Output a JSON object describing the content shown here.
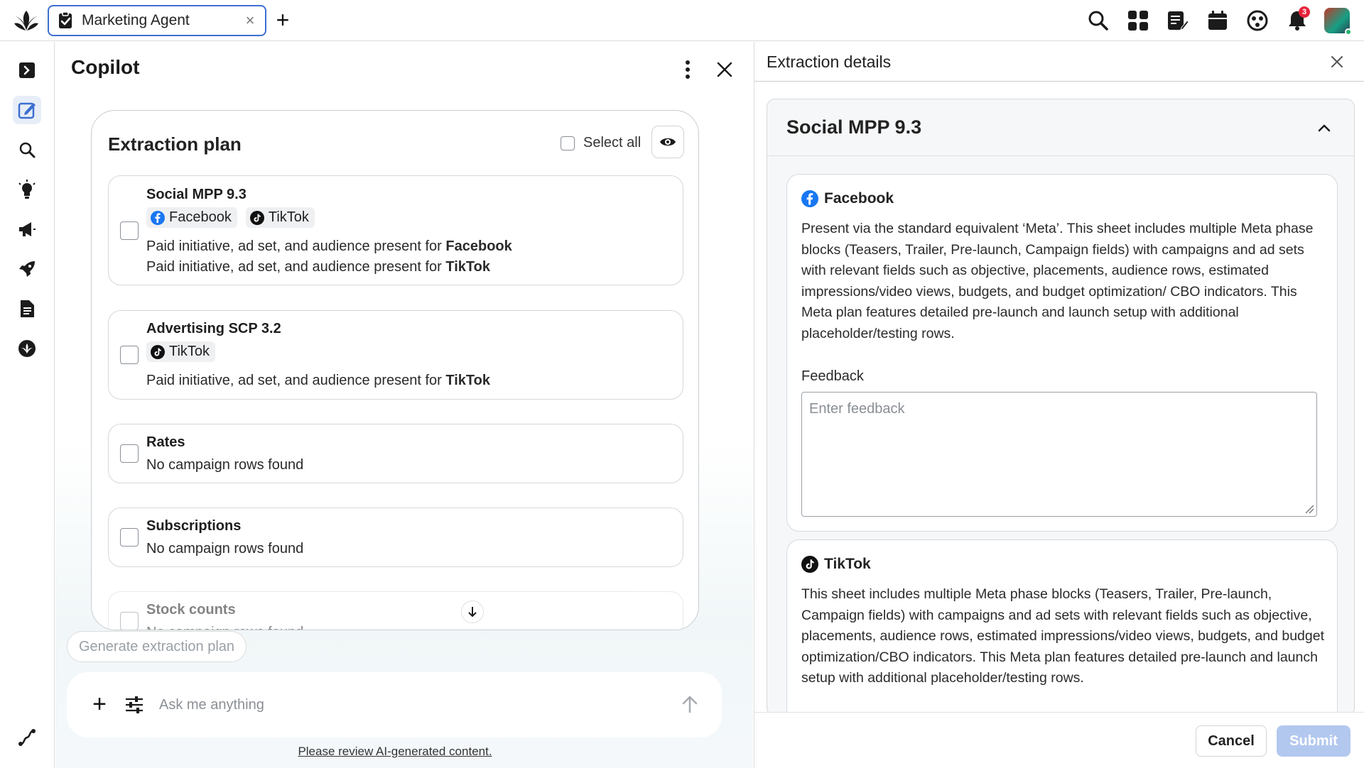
{
  "top_bar": {
    "tab_label": "Marketing Agent",
    "tab_close": "×",
    "new_tab": "+",
    "notification_count": "3",
    "icons": [
      "logo-icon",
      "search-icon",
      "apps-grid-icon",
      "notes-icon",
      "calendar-icon",
      "smiley-icon",
      "bell-icon",
      "avatar"
    ]
  },
  "left_rail": {
    "items": [
      "panel-toggle-icon",
      "edit-icon",
      "search-icon",
      "lightbulb-icon",
      "megaphone-icon",
      "rocket-icon",
      "document-icon",
      "leaf-icon",
      "flow-icon"
    ]
  },
  "copilot": {
    "title": "Copilot",
    "plan": {
      "title": "Extraction plan",
      "select_all": "Select all",
      "items": [
        {
          "title": "Social MPP 9.3",
          "chips": [
            "Facebook",
            "TikTok"
          ],
          "lines": [
            {
              "text": "Paid initiative, ad set, and audience present for ",
              "bold": "Facebook"
            },
            {
              "text": "Paid initiative, ad set, and audience present for ",
              "bold": "TikTok"
            }
          ]
        },
        {
          "title": "Advertising SCP 3.2",
          "chips": [
            "TikTok"
          ],
          "lines": [
            {
              "text": "Paid initiative, ad set, and audience present for ",
              "bold": "TikTok"
            }
          ]
        },
        {
          "title": "Rates",
          "lines": [
            {
              "text": "No campaign rows found",
              "bold": ""
            }
          ]
        },
        {
          "title": "Subscriptions",
          "lines": [
            {
              "text": "No campaign rows found",
              "bold": ""
            }
          ]
        },
        {
          "title": "Stock counts",
          "lines": [
            {
              "text": "No campaign rows found",
              "bold": ""
            }
          ]
        }
      ]
    },
    "generate_button": "Generate extraction plan",
    "chat": {
      "plus": "+",
      "placeholder": "Ask me anything"
    },
    "review_link": "Please review AI-generated content."
  },
  "details": {
    "title": "Extraction details",
    "section_title": "Social MPP 9.3",
    "platforms": [
      {
        "name": "Facebook",
        "description": "Present via the standard equivalent ‘Meta’. This sheet includes multiple Meta phase blocks (Teasers, Trailer, Pre-launch, Campaign fields) with campaigns and ad sets with relevant fields such as objective, placements, audience rows, estimated impressions/video views, budgets, and budget optimization/ CBO indicators. This Meta plan features detailed pre-launch and launch setup with additional placeholder/testing rows.",
        "feedback_label": "Feedback",
        "feedback_placeholder": "Enter feedback"
      },
      {
        "name": "TikTok",
        "description": "This sheet includes multiple Meta phase blocks (Teasers, Trailer, Pre-launch, Campaign fields) with campaigns and ad sets with relevant fields such as objective, placements, audience rows, estimated impressions/video views, budgets, and budget optimization/CBO indicators. This Meta plan features detailed pre-launch and launch setup with additional placeholder/testing rows."
      }
    ],
    "cancel": "Cancel",
    "submit": "Submit"
  },
  "colors": {
    "accent": "#3c6fd1",
    "submit_disabled": "#b3c8ef",
    "badge": "#e5243b",
    "facebook": "#1877f2"
  }
}
